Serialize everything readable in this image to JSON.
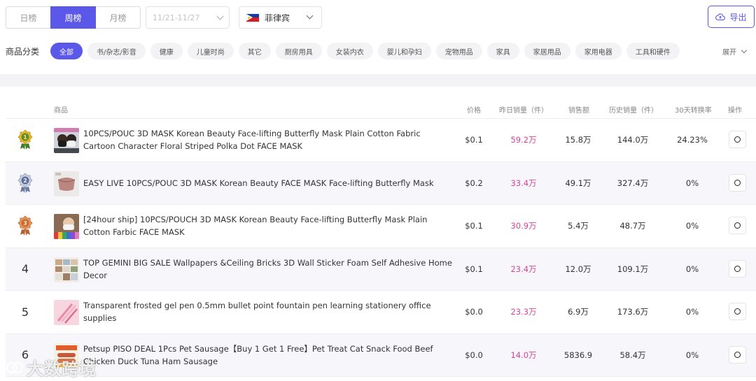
{
  "toolbar": {
    "periods": [
      "日榜",
      "周榜",
      "月榜"
    ],
    "active_period": "周榜",
    "date_range": "11/21-11/27",
    "country": "菲律宾",
    "export_label": "导出"
  },
  "categories": {
    "label": "商品分类",
    "items": [
      "全部",
      "书/杂志/影音",
      "健康",
      "儿童时尚",
      "其它",
      "厨房用具",
      "女装内衣",
      "婴儿和孕妇",
      "宠物用品",
      "家具",
      "家居用品",
      "家用电器",
      "工具和硬件"
    ],
    "active": "全部",
    "expand_label": "展开"
  },
  "table": {
    "headers": {
      "product": "商品",
      "price": "价格",
      "yesterday_sales": "昨日销量（件）",
      "revenue": "销售额",
      "history_sales": "历史销量（件）",
      "conversion": "30天转换率",
      "action": "操作"
    },
    "rows": [
      {
        "rank": "1",
        "title": "10PCS/POUC 3D MASK Korean Beauty Face-lifting Butterfly Mask Plain Cotton Fabric Cartoon Character Floral Striped Polka Dot FACE MASK",
        "price": "$0.1",
        "yesterday": "59.2万",
        "revenue": "15.8万",
        "history": "144.0万",
        "conversion": "24.23%"
      },
      {
        "rank": "2",
        "title": "EASY LIVE 10PCS/POUC 3D MASK Korean Beauty FACE MASK Face-lifting Butterfly Mask",
        "price": "$0.2",
        "yesterday": "33.4万",
        "revenue": "49.1万",
        "history": "327.4万",
        "conversion": "0%"
      },
      {
        "rank": "3",
        "title": "[24hour ship] 10PCS/POUCH 3D MASK Korean Beauty Face-lifting Butterfly Mask Plain Cotton Farbic FACE MASK",
        "price": "$0.1",
        "yesterday": "30.9万",
        "revenue": "5.4万",
        "history": "48.7万",
        "conversion": "0%"
      },
      {
        "rank": "4",
        "title": "TOP GEMINI BIG SALE Wallpapers &Ceiling Bricks 3D Wall Sticker Foam Self Adhesive Home Decor",
        "price": "$0.1",
        "yesterday": "23.4万",
        "revenue": "12.0万",
        "history": "109.1万",
        "conversion": "0%"
      },
      {
        "rank": "5",
        "title": "Transparent frosted gel pen 0.5mm bullet point fountain pen learning stationery office supplies",
        "price": "$0.0",
        "yesterday": "23.3万",
        "revenue": "6.9万",
        "history": "173.6万",
        "conversion": "0%"
      },
      {
        "rank": "6",
        "title": "Petsup PISO DEAL 1Pcs Pet Sausage【Buy 1 Get 1 Free】Pet Treat Cat Snack Food Beef Chicken Duck Tuna Ham Sausage",
        "price": "$0.0",
        "yesterday": "14.0万",
        "revenue": "5836.9",
        "history": "58.4万",
        "conversion": "0%"
      }
    ]
  },
  "medals": [
    "gold-medal-icon",
    "silver-medal-icon",
    "bronze-medal-icon"
  ],
  "colors": {
    "accent": "#5b57e8",
    "sales_highlight": "#d6449a"
  },
  "watermark": "大数跨境"
}
